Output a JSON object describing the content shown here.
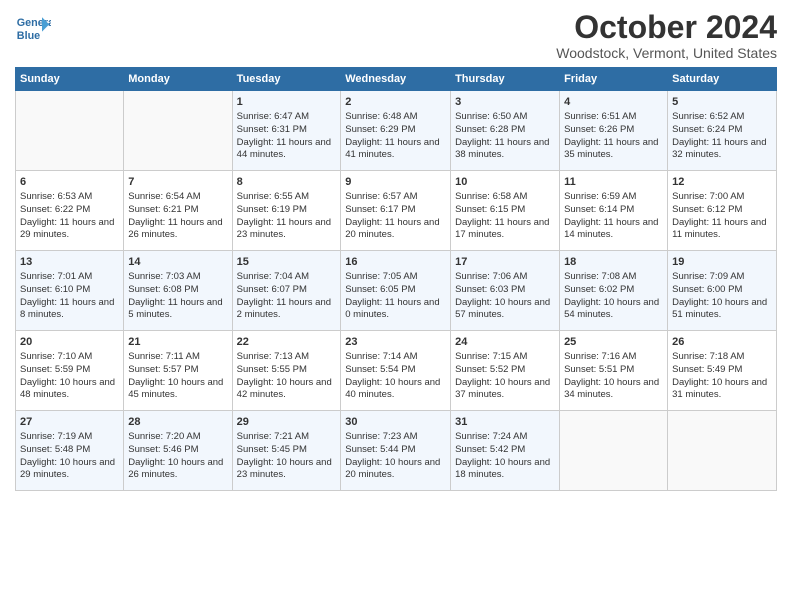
{
  "header": {
    "logo_line1": "General",
    "logo_line2": "Blue",
    "title": "October 2024",
    "subtitle": "Woodstock, Vermont, United States"
  },
  "days_of_week": [
    "Sunday",
    "Monday",
    "Tuesday",
    "Wednesday",
    "Thursday",
    "Friday",
    "Saturday"
  ],
  "weeks": [
    [
      {
        "day": "",
        "info": ""
      },
      {
        "day": "",
        "info": ""
      },
      {
        "day": "1",
        "sunrise": "6:47 AM",
        "sunset": "6:31 PM",
        "daylight": "11 hours and 44 minutes."
      },
      {
        "day": "2",
        "sunrise": "6:48 AM",
        "sunset": "6:29 PM",
        "daylight": "11 hours and 41 minutes."
      },
      {
        "day": "3",
        "sunrise": "6:50 AM",
        "sunset": "6:28 PM",
        "daylight": "11 hours and 38 minutes."
      },
      {
        "day": "4",
        "sunrise": "6:51 AM",
        "sunset": "6:26 PM",
        "daylight": "11 hours and 35 minutes."
      },
      {
        "day": "5",
        "sunrise": "6:52 AM",
        "sunset": "6:24 PM",
        "daylight": "11 hours and 32 minutes."
      }
    ],
    [
      {
        "day": "6",
        "sunrise": "6:53 AM",
        "sunset": "6:22 PM",
        "daylight": "11 hours and 29 minutes."
      },
      {
        "day": "7",
        "sunrise": "6:54 AM",
        "sunset": "6:21 PM",
        "daylight": "11 hours and 26 minutes."
      },
      {
        "day": "8",
        "sunrise": "6:55 AM",
        "sunset": "6:19 PM",
        "daylight": "11 hours and 23 minutes."
      },
      {
        "day": "9",
        "sunrise": "6:57 AM",
        "sunset": "6:17 PM",
        "daylight": "11 hours and 20 minutes."
      },
      {
        "day": "10",
        "sunrise": "6:58 AM",
        "sunset": "6:15 PM",
        "daylight": "11 hours and 17 minutes."
      },
      {
        "day": "11",
        "sunrise": "6:59 AM",
        "sunset": "6:14 PM",
        "daylight": "11 hours and 14 minutes."
      },
      {
        "day": "12",
        "sunrise": "7:00 AM",
        "sunset": "6:12 PM",
        "daylight": "11 hours and 11 minutes."
      }
    ],
    [
      {
        "day": "13",
        "sunrise": "7:01 AM",
        "sunset": "6:10 PM",
        "daylight": "11 hours and 8 minutes."
      },
      {
        "day": "14",
        "sunrise": "7:03 AM",
        "sunset": "6:08 PM",
        "daylight": "11 hours and 5 minutes."
      },
      {
        "day": "15",
        "sunrise": "7:04 AM",
        "sunset": "6:07 PM",
        "daylight": "11 hours and 2 minutes."
      },
      {
        "day": "16",
        "sunrise": "7:05 AM",
        "sunset": "6:05 PM",
        "daylight": "11 hours and 0 minutes."
      },
      {
        "day": "17",
        "sunrise": "7:06 AM",
        "sunset": "6:03 PM",
        "daylight": "10 hours and 57 minutes."
      },
      {
        "day": "18",
        "sunrise": "7:08 AM",
        "sunset": "6:02 PM",
        "daylight": "10 hours and 54 minutes."
      },
      {
        "day": "19",
        "sunrise": "7:09 AM",
        "sunset": "6:00 PM",
        "daylight": "10 hours and 51 minutes."
      }
    ],
    [
      {
        "day": "20",
        "sunrise": "7:10 AM",
        "sunset": "5:59 PM",
        "daylight": "10 hours and 48 minutes."
      },
      {
        "day": "21",
        "sunrise": "7:11 AM",
        "sunset": "5:57 PM",
        "daylight": "10 hours and 45 minutes."
      },
      {
        "day": "22",
        "sunrise": "7:13 AM",
        "sunset": "5:55 PM",
        "daylight": "10 hours and 42 minutes."
      },
      {
        "day": "23",
        "sunrise": "7:14 AM",
        "sunset": "5:54 PM",
        "daylight": "10 hours and 40 minutes."
      },
      {
        "day": "24",
        "sunrise": "7:15 AM",
        "sunset": "5:52 PM",
        "daylight": "10 hours and 37 minutes."
      },
      {
        "day": "25",
        "sunrise": "7:16 AM",
        "sunset": "5:51 PM",
        "daylight": "10 hours and 34 minutes."
      },
      {
        "day": "26",
        "sunrise": "7:18 AM",
        "sunset": "5:49 PM",
        "daylight": "10 hours and 31 minutes."
      }
    ],
    [
      {
        "day": "27",
        "sunrise": "7:19 AM",
        "sunset": "5:48 PM",
        "daylight": "10 hours and 29 minutes."
      },
      {
        "day": "28",
        "sunrise": "7:20 AM",
        "sunset": "5:46 PM",
        "daylight": "10 hours and 26 minutes."
      },
      {
        "day": "29",
        "sunrise": "7:21 AM",
        "sunset": "5:45 PM",
        "daylight": "10 hours and 23 minutes."
      },
      {
        "day": "30",
        "sunrise": "7:23 AM",
        "sunset": "5:44 PM",
        "daylight": "10 hours and 20 minutes."
      },
      {
        "day": "31",
        "sunrise": "7:24 AM",
        "sunset": "5:42 PM",
        "daylight": "10 hours and 18 minutes."
      },
      {
        "day": "",
        "info": ""
      },
      {
        "day": "",
        "info": ""
      }
    ]
  ]
}
